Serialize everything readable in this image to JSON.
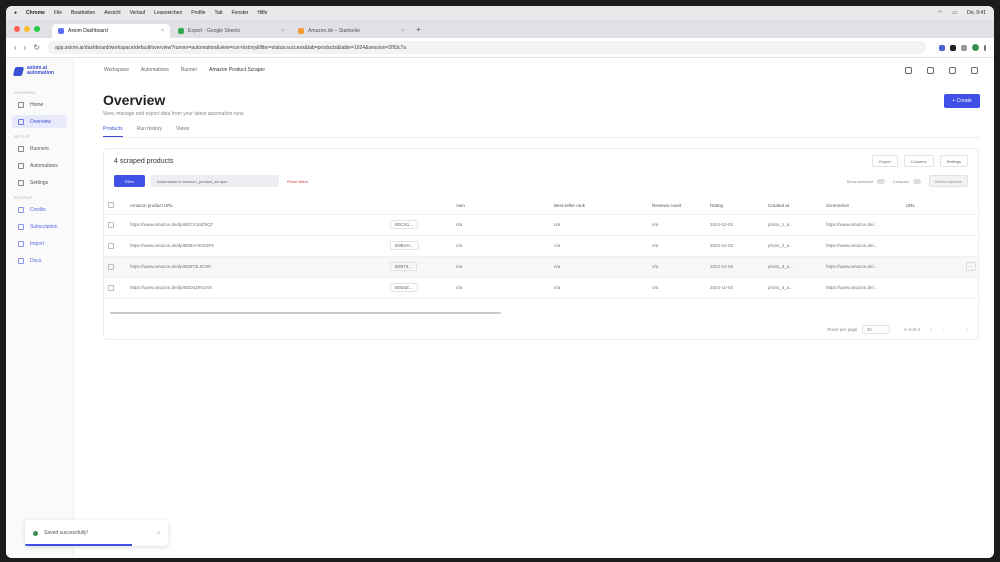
{
  "menubar": {
    "app": "Chrome",
    "items": [
      "File",
      "Bearbeiten",
      "Ansicht",
      "Verlauf",
      "Lesezeichen",
      "Profile",
      "Tab",
      "Fenster",
      "Hilfe"
    ],
    "clock": "Do. 9:41"
  },
  "browser": {
    "tabs": [
      {
        "label": "Axiom Dashboard",
        "active": true
      },
      {
        "label": "Export · Google Sheets",
        "active": false
      },
      {
        "label": "Amazon.de – Startseite",
        "active": false
      }
    ],
    "url": "app.axiom.ai/dashboard/workspace/default/overview?runner=automation&view=run-history&filter=status:success&tab=products&table=1024&session=2f93c7a"
  },
  "sidebar": {
    "logo": "axiom.ai automation",
    "groups": [
      {
        "title": "GENERAL",
        "items": [
          {
            "label": "Home",
            "active": false
          },
          {
            "label": "Overview",
            "active": true
          }
        ]
      },
      {
        "title": "SETUP",
        "items": [
          {
            "label": "Runners",
            "active": false
          },
          {
            "label": "Automations",
            "active": false
          },
          {
            "label": "Settings",
            "active": false
          }
        ]
      },
      {
        "title": "EXTRAS",
        "items": [
          {
            "label": "Credits",
            "active": false
          },
          {
            "label": "Subscription",
            "active": false
          },
          {
            "label": "Import",
            "active": false
          },
          {
            "label": "Docs",
            "active": false
          }
        ]
      }
    ]
  },
  "topbar": {
    "crumbs": [
      "Workspace",
      "Automations",
      "Runner",
      "Amazon Product Scraper"
    ]
  },
  "page": {
    "title": "Overview",
    "subtitle": "View, manage and export data from your latest automation runs",
    "primary_button": "+ Create",
    "subtabs": [
      "Products",
      "Run history",
      "Views"
    ]
  },
  "card": {
    "title": "4 scraped products",
    "actions": [
      "Export",
      "Columns",
      "Settings"
    ],
    "filter_button": "Filter",
    "filter_chip": "Automation is amazon_product_scraper",
    "reset": "Reset filters",
    "toggle_label_1": "Show archived",
    "toggle_label_2": "Compact",
    "select_button": "Select columns"
  },
  "table": {
    "columns": [
      "Amazon product URL",
      "Asin",
      "Best seller rank",
      "Reviews count",
      "Rating",
      "Created at",
      "Screenshot",
      "URL"
    ],
    "rows": [
      {
        "url": "https://www.amazon.de/dp/B0CX1MZ9Q7",
        "asin": "B0CX1...",
        "a": "n/a",
        "b": "n/a",
        "c": "n/a",
        "date": "2024-10-02",
        "shot": "photo_1_a...",
        "link": "https://www.amazon.de/..."
      },
      {
        "url": "https://www.amazon.de/dp/B0BVHKW3P2",
        "asin": "B0BVH...",
        "a": "n/a",
        "b": "n/a",
        "c": "n/a",
        "date": "2024-10-02",
        "shot": "photo_2_a...",
        "link": "https://www.amazon.de/..."
      },
      {
        "url": "https://www.amazon.de/dp/B09T3L6C8R",
        "asin": "B09T3...",
        "a": "n/a",
        "b": "n/a",
        "c": "n/a",
        "date": "2024-10-02",
        "shot": "photo_3_a...",
        "link": "https://www.amazon.de/..."
      },
      {
        "url": "https://www.amazon.de/dp/B0D4Z8N1XK",
        "asin": "B0D4Z...",
        "a": "n/a",
        "b": "n/a",
        "c": "n/a",
        "date": "2024-10-02",
        "shot": "photo_4_a...",
        "link": "https://www.amazon.de/..."
      }
    ]
  },
  "pager": {
    "rows_label": "Rows per page",
    "rows_value": "25",
    "range": "1–4 of 4"
  },
  "toast": {
    "text": "Saved successfully!",
    "progress": 0.75
  },
  "colors": {
    "accent": "#3f51e6",
    "danger": "#d64545"
  }
}
